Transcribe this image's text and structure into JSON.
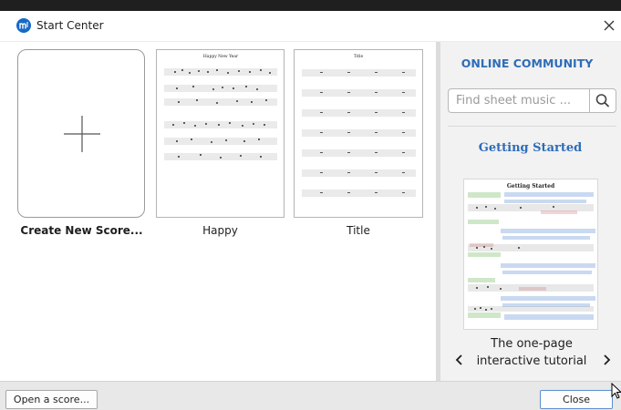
{
  "window": {
    "title": "Start Center",
    "app_icon": "musescore-logo-icon",
    "close_icon": "close-icon"
  },
  "scores": [
    {
      "label": "Create New Score...",
      "kind": "new",
      "icon": "plus-icon"
    },
    {
      "label": "Happy",
      "kind": "thumbnail",
      "sheet_title": "Happy New Year"
    },
    {
      "label": "Title",
      "kind": "thumbnail",
      "sheet_title": "Title"
    }
  ],
  "sidebar": {
    "heading": "ONLINE COMMUNITY",
    "search": {
      "placeholder": "Find sheet music ...",
      "value": "",
      "icon": "search-icon"
    },
    "getting_started": "Getting Started",
    "tutorial": {
      "line1": "The one-page",
      "line2": "interactive tutorial",
      "thumb_title": "Getting Started",
      "prev_icon": "chevron-left-icon",
      "next_icon": "chevron-right-icon"
    }
  },
  "footer": {
    "open_label": "Open a score...",
    "close_label": "Close"
  },
  "colors": {
    "accent": "#2e6db8",
    "app_icon_bg": "#1569c7",
    "panel_bg": "#f2f2f2",
    "footer_bg": "#e8e8e8"
  }
}
